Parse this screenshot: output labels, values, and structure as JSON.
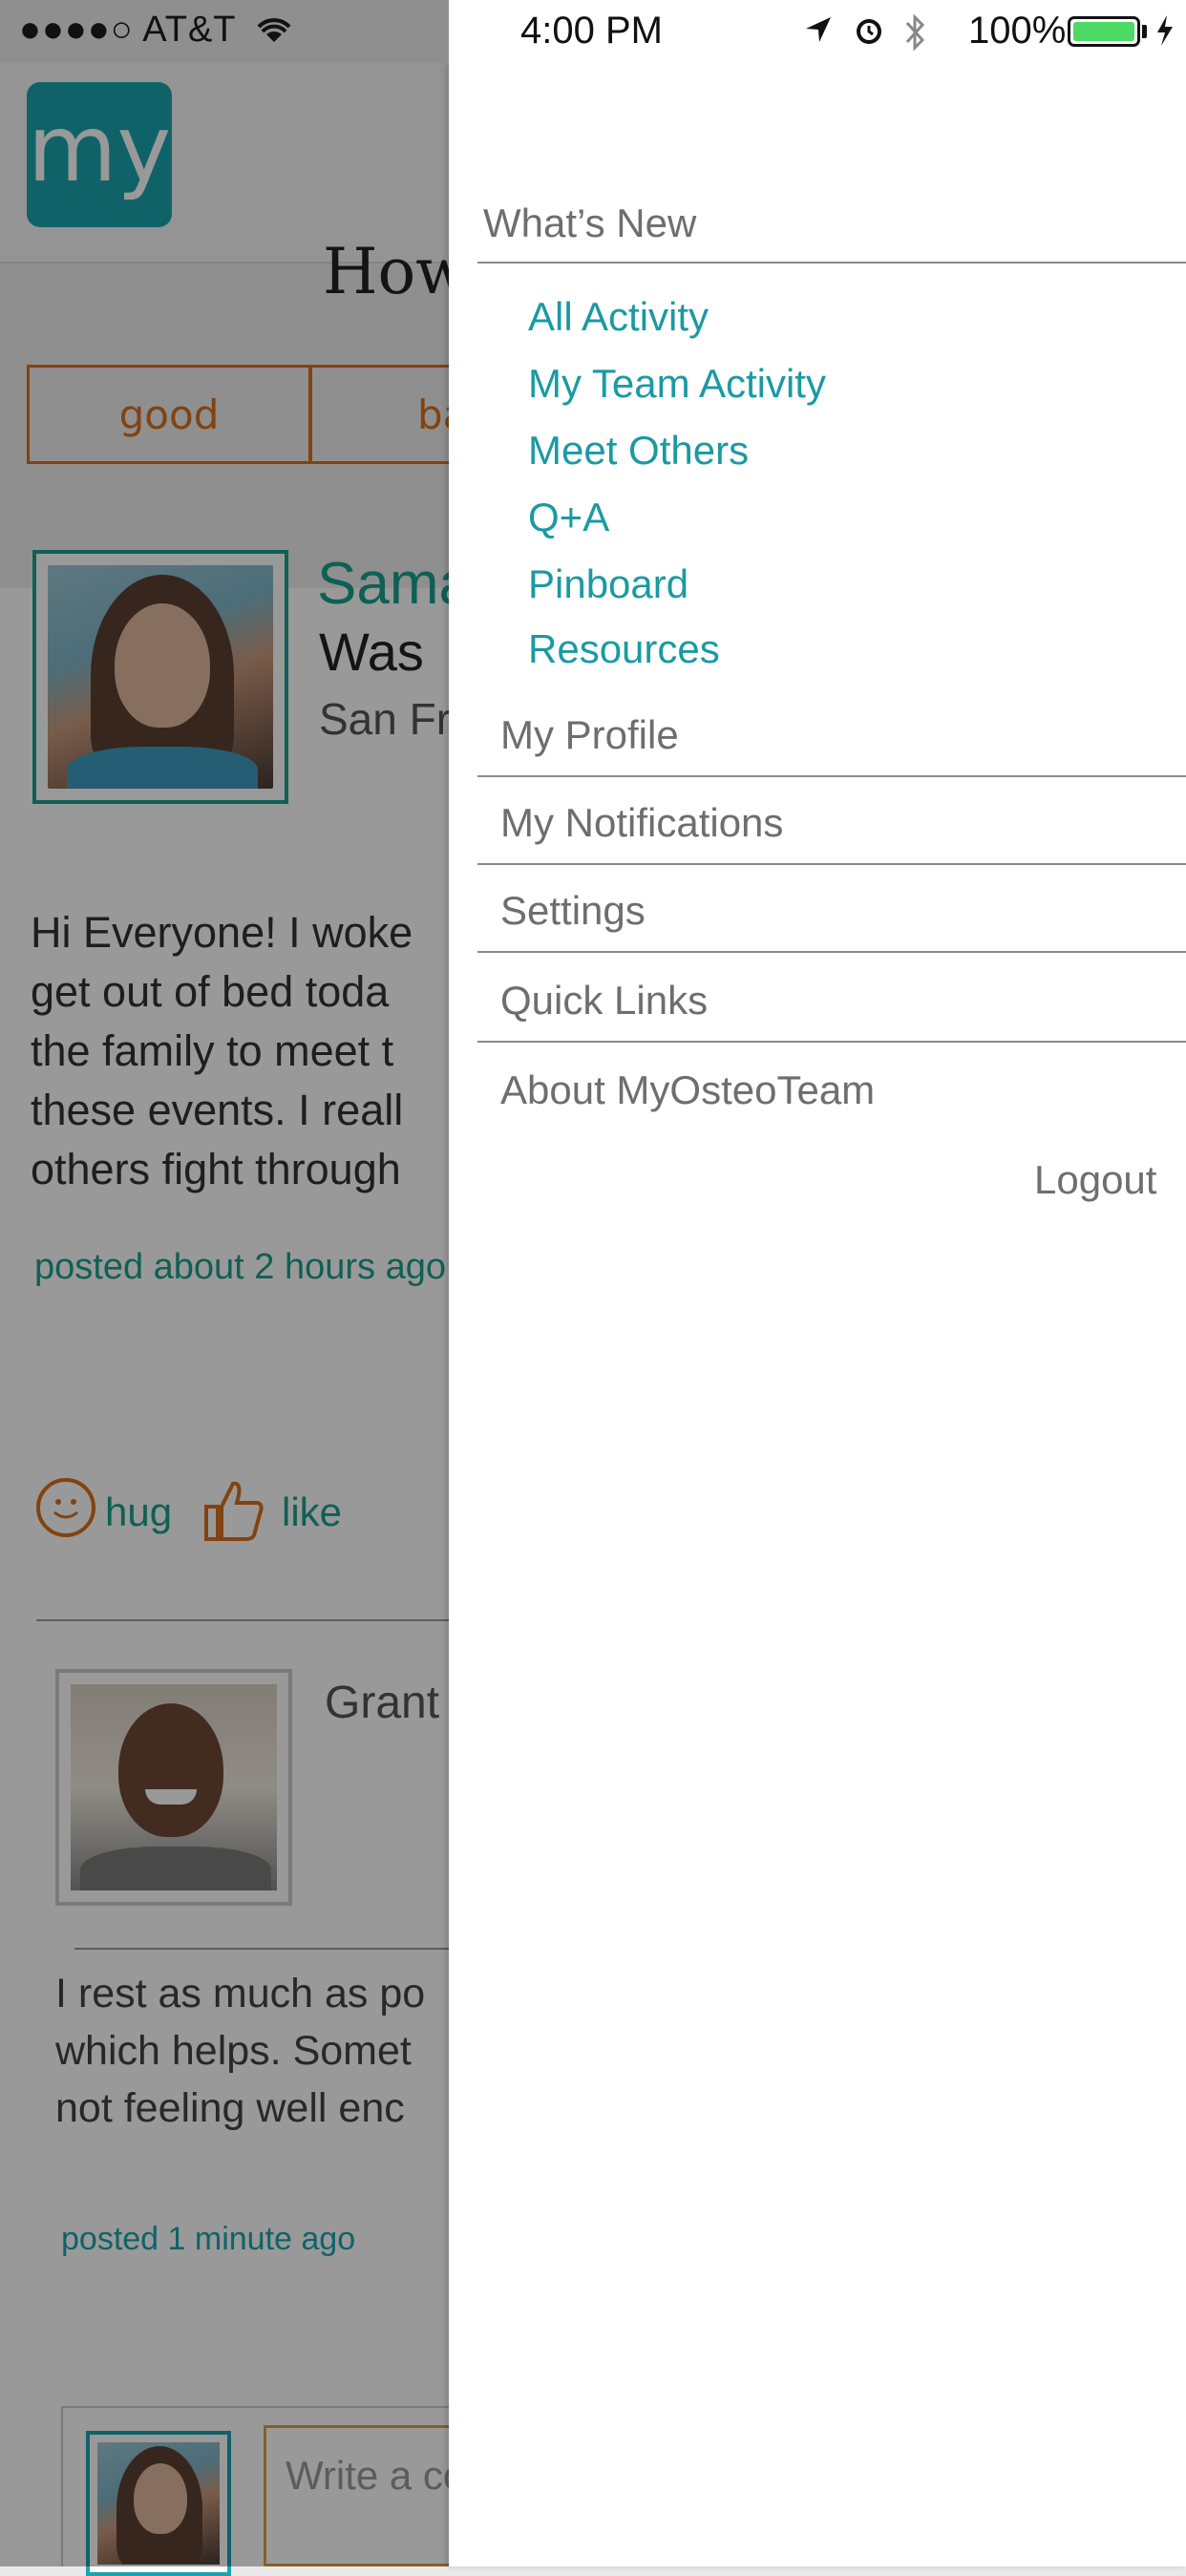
{
  "status_bar": {
    "carrier": "●●●●○ AT&T",
    "time": "4:00 PM",
    "battery": "100%",
    "battery_color": "#4cd964"
  },
  "background_app": {
    "logo": "my",
    "question": "How",
    "mood_buttons": [
      "good",
      "ba"
    ],
    "post": {
      "name": "Sama",
      "was": "Was",
      "location": "San Fr",
      "body": "Hi Everyone! I woke\nget out of bed toda\nthe family to meet t\nthese events. I reall\nothers fight through",
      "posted": "posted about 2 hours ago",
      "hug": "hug",
      "like": "like"
    },
    "comment": {
      "name": "Grant",
      "body": "I rest as much as po\nwhich helps. Somet\nnot feeling well enc",
      "posted": "posted 1 minute ago"
    },
    "reply_placeholder": "Write a co"
  },
  "drawer": {
    "whats_new": "What’s New",
    "sub_items": [
      "All Activity",
      "My Team Activity",
      "Meet Others",
      "Q+A",
      "Pinboard",
      "Resources"
    ],
    "menu_items": [
      "My Profile",
      "My Notifications",
      "Settings",
      "Quick Links",
      "About MyOsteoTeam"
    ],
    "logout": "Logout"
  },
  "colors": {
    "brand_teal": "#1aa5ad",
    "accent_orange": "#d9701c",
    "menu_gray": "#6e6e6e"
  }
}
